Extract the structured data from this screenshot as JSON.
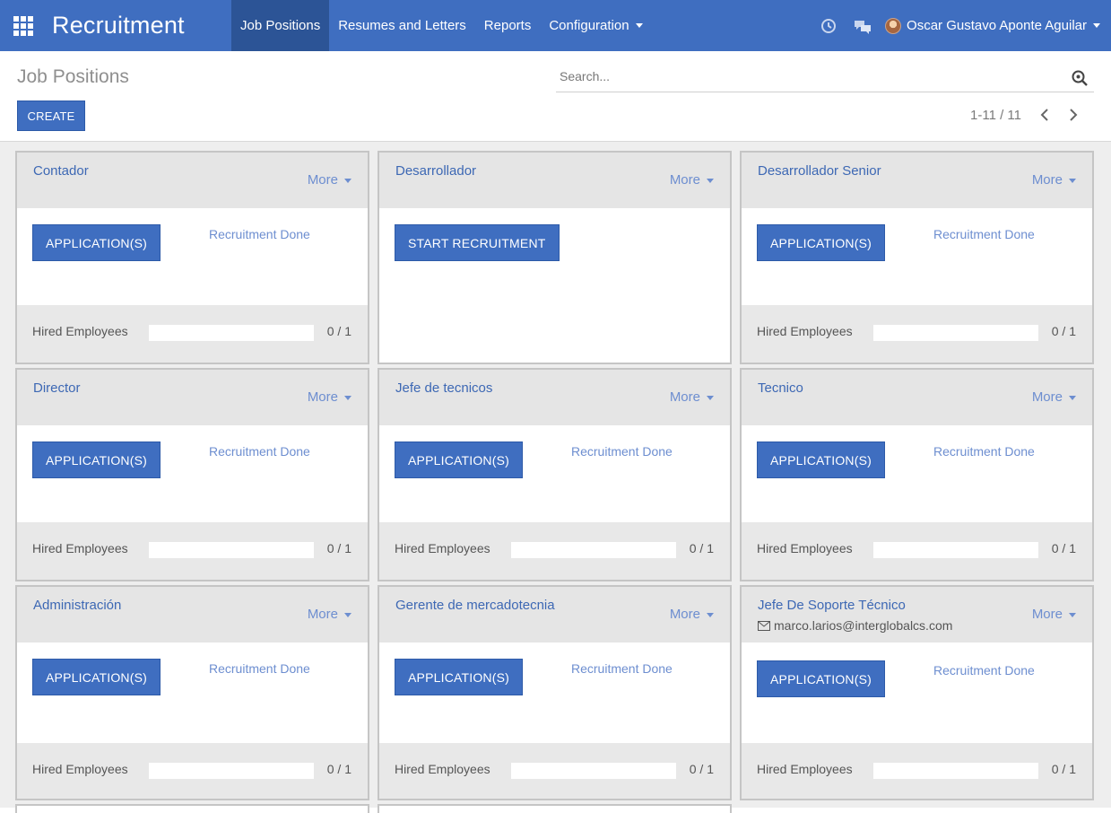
{
  "navbar": {
    "brand": "Recruitment",
    "items": [
      {
        "label": "Job Positions",
        "active": true
      },
      {
        "label": "Resumes and Letters",
        "active": false
      },
      {
        "label": "Reports",
        "active": false
      },
      {
        "label": "Configuration",
        "active": false,
        "dropdown": true
      }
    ],
    "icons": [
      "apps-grid-icon",
      "activity-clock-icon",
      "chat-bubbles-icon"
    ],
    "user_name": "Oscar Gustavo Aponte Aguilar"
  },
  "control": {
    "title": "Job Positions",
    "create_label": "CREATE",
    "search_placeholder": "Search...",
    "pager": "1-11 / 11"
  },
  "cards": [
    {
      "title": "Contador",
      "more": "More",
      "button": "APPLICATION(S)",
      "done": "Recruitment Done",
      "hired_label": "Hired Employees",
      "hired": "0 / 1",
      "hired_fraction": 0
    },
    {
      "title": "Desarrollador",
      "more": "More",
      "button": "START RECRUITMENT",
      "done": "",
      "hired_label": "",
      "hired": "",
      "hired_fraction": 0
    },
    {
      "title": "Desarrollador Senior",
      "more": "More",
      "button": "APPLICATION(S)",
      "done": "Recruitment Done",
      "hired_label": "Hired Employees",
      "hired": "0 / 1",
      "hired_fraction": 0
    },
    {
      "title": "Director",
      "more": "More",
      "button": "APPLICATION(S)",
      "done": "Recruitment Done",
      "hired_label": "Hired Employees",
      "hired": "0 / 1",
      "hired_fraction": 0
    },
    {
      "title": "Jefe de tecnicos",
      "more": "More",
      "button": "APPLICATION(S)",
      "done": "Recruitment Done",
      "hired_label": "Hired Employees",
      "hired": "0 / 1",
      "hired_fraction": 0
    },
    {
      "title": "Tecnico",
      "more": "More",
      "button": "APPLICATION(S)",
      "done": "Recruitment Done",
      "hired_label": "Hired Employees",
      "hired": "0 / 1",
      "hired_fraction": 0
    },
    {
      "title": "Administración",
      "more": "More",
      "button": "APPLICATION(S)",
      "done": "Recruitment Done",
      "hired_label": "Hired Employees",
      "hired": "0 / 1",
      "hired_fraction": 0
    },
    {
      "title": "Gerente de mercadotecnia",
      "more": "More",
      "button": "APPLICATION(S)",
      "done": "Recruitment Done",
      "hired_label": "Hired Employees",
      "hired": "0 / 1",
      "hired_fraction": 0
    },
    {
      "title": "Jefe De Soporte Técnico",
      "email": "marco.larios@interglobalcs.com",
      "more": "More",
      "button": "APPLICATION(S)",
      "done": "Recruitment Done",
      "hired_label": "Hired Employees",
      "hired": "0 / 1",
      "hired_fraction": 0
    }
  ],
  "colors": {
    "primary": "#3f6ec0",
    "navbar_active": "#2c5496",
    "link": "#6d8ed0"
  }
}
